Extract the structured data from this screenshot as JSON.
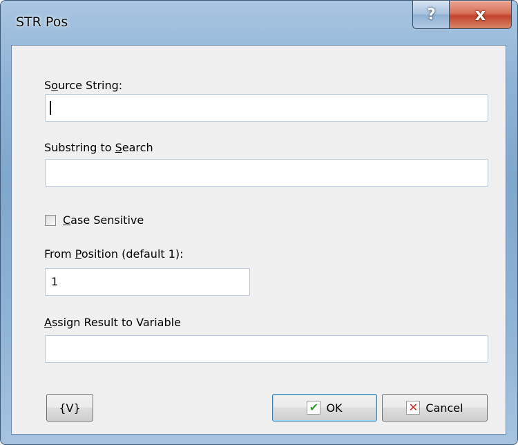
{
  "window": {
    "title": "STR Pos",
    "help_glyph": "?",
    "close_glyph": "x"
  },
  "form": {
    "source_label_pre": "S",
    "source_label_ul": "o",
    "source_label_post": "urce String:",
    "source_value": "",
    "substring_label_pre": "Substring to ",
    "substring_label_ul": "S",
    "substring_label_post": "earch",
    "substring_value": "",
    "case_label_ul": "C",
    "case_label_post": "ase Sensitive",
    "case_checked": false,
    "from_label_pre": "From ",
    "from_label_ul": "P",
    "from_label_post": "osition (default 1):",
    "from_value": "1",
    "assign_label_ul": "A",
    "assign_label_post": "ssign Result to Variable",
    "assign_value": ""
  },
  "buttons": {
    "var_label": "{V}",
    "ok_label": "OK",
    "cancel_label": "Cancel"
  },
  "icons": {
    "ok": "check-icon",
    "cancel": "x-icon",
    "ok_color": "#2d9a2d",
    "cancel_color": "#d0201a"
  }
}
